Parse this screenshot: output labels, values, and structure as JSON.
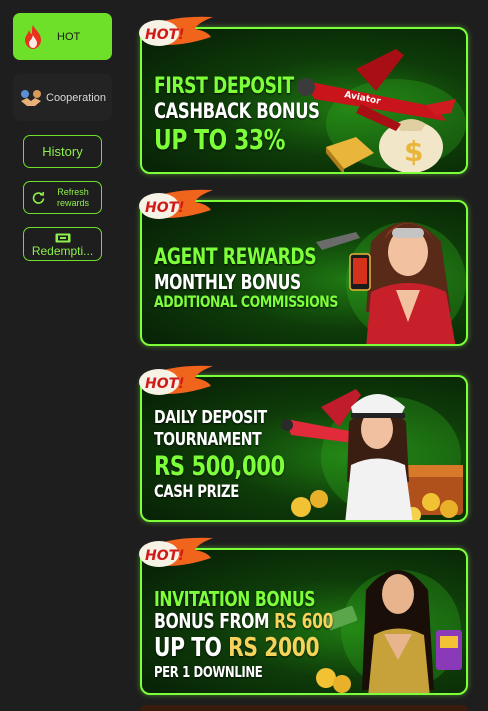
{
  "sidebar": {
    "hot_label": "HOT",
    "cooperation_label": "Cooperation",
    "history_label": "History",
    "refresh_label": "Refresh rewards",
    "redeem_label": "Redempti..."
  },
  "banners": [
    {
      "badge": "HOT!",
      "line1": "FIRST DEPOSIT",
      "line2": "CASHBACK BONUS",
      "line3": "UP TO 33%",
      "plane_text": "Aviator"
    },
    {
      "badge": "HOT!",
      "line1": "AGENT REWARDS",
      "line2": "MONTHLY BONUS",
      "line3": "ADDITIONAL COMMISSIONS"
    },
    {
      "badge": "HOT!",
      "line1": "DAILY DEPOSIT",
      "line2": "TOURNAMENT",
      "line3": "Rs 500,000",
      "line4": "CASH PRIZE"
    },
    {
      "badge": "HOT!",
      "line1": "INVITATION BONUS",
      "line2a": "BONUS FROM ",
      "line2b": "Rs 600",
      "line3a": "UP TO ",
      "line3b": "Rs 2000",
      "line4": "PER 1 DOWNLINE"
    }
  ],
  "colors": {
    "accent_green": "#6fe02a",
    "background": "#1e1e1e",
    "banner_border": "#7dff3a",
    "gold": "#f6d35a"
  }
}
